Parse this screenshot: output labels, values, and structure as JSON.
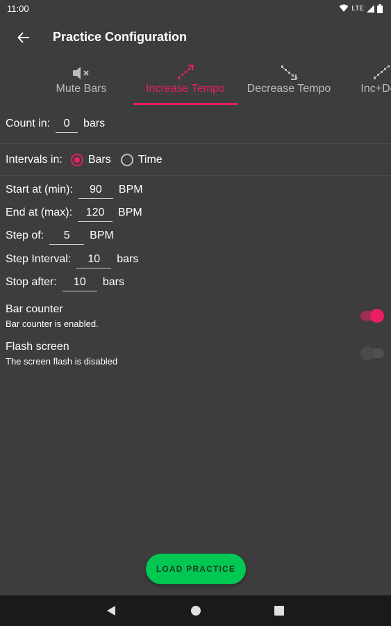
{
  "status_bar": {
    "time": "11:00",
    "network": "LTE"
  },
  "app_bar": {
    "title": "Practice Configuration",
    "back_icon": "arrow-back-icon"
  },
  "tabs": [
    {
      "label": "Mute Bars",
      "icon": "volume-mute-icon",
      "active": false
    },
    {
      "label": "Increase Tempo",
      "icon": "steps-up-icon",
      "active": true
    },
    {
      "label": "Decrease Tempo",
      "icon": "steps-down-icon",
      "active": false
    },
    {
      "label": "Inc+Dec",
      "icon": "steps-up-down-icon",
      "active": false
    }
  ],
  "count_in": {
    "label": "Count in:",
    "value": "0",
    "unit": "bars"
  },
  "intervals": {
    "label": "Intervals in:",
    "options": [
      {
        "label": "Bars",
        "checked": true
      },
      {
        "label": "Time",
        "checked": false
      }
    ]
  },
  "fields": {
    "start_at": {
      "label": "Start at (min):",
      "value": "90",
      "unit": "BPM"
    },
    "end_at": {
      "label": "End at (max):",
      "value": "120",
      "unit": "BPM"
    },
    "step_of": {
      "label": "Step of:",
      "value": "5",
      "unit": "BPM"
    },
    "step_interval": {
      "label": "Step Interval:",
      "value": "10",
      "unit": "bars"
    },
    "stop_after": {
      "label": "Stop after:",
      "value": "10",
      "unit": "bars"
    }
  },
  "settings": {
    "bar_counter": {
      "title": "Bar counter",
      "subtitle": "Bar counter is enabled.",
      "enabled": true
    },
    "flash_screen": {
      "title": "Flash screen",
      "subtitle": "The screen flash is disabled",
      "enabled": false
    }
  },
  "fab": {
    "label": "LOAD PRACTICE"
  },
  "colors": {
    "accent": "#e91e63",
    "background": "#3d3d3d",
    "fab": "#00c853"
  }
}
